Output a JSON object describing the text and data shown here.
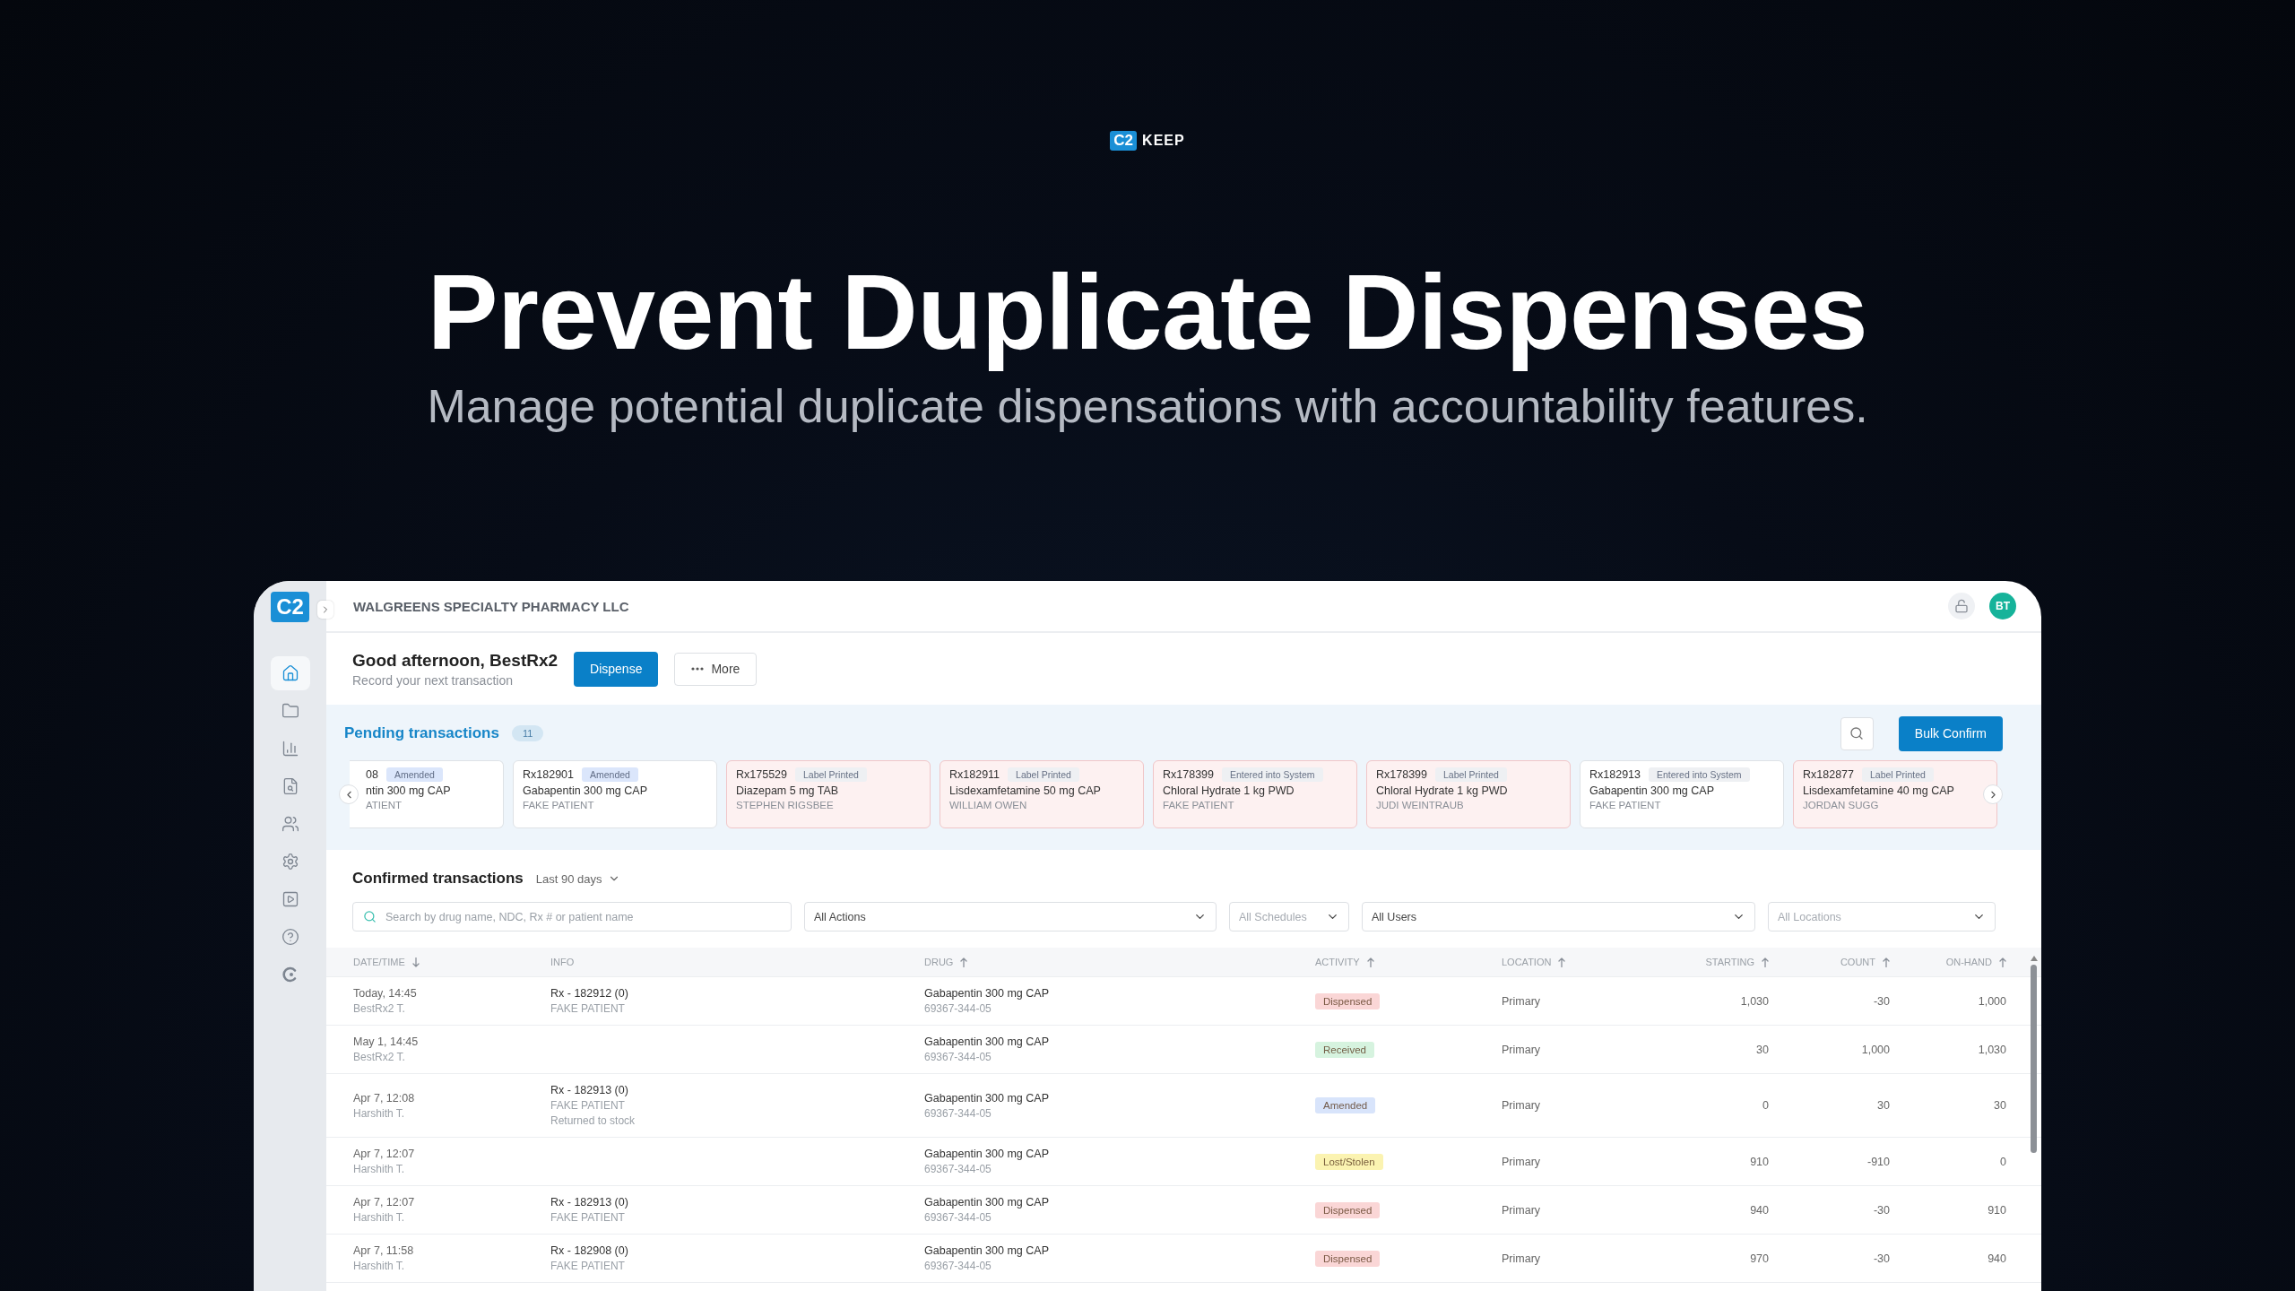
{
  "brand": {
    "mark": "C2",
    "name": "KEEP"
  },
  "headline": "Prevent Duplicate Dispenses",
  "subtitle": "Manage potential duplicate dispensations with accountability features.",
  "app": {
    "sidebar": {
      "logo": "C2",
      "nav": [
        {
          "selected": true
        },
        {
          "selected": false
        },
        {
          "selected": false
        },
        {
          "selected": false
        },
        {
          "selected": false
        },
        {
          "selected": false
        },
        {
          "selected": false
        },
        {
          "selected": false
        },
        {
          "selected": false
        }
      ]
    },
    "topbar": {
      "org": "WALGREENS SPECIALTY PHARMACY LLC",
      "locked": false,
      "avatar": "BT"
    },
    "greeting": {
      "title": "Good afternoon, BestRx2",
      "subtitle": "Record your next transaction"
    },
    "actions": [
      {
        "label": "Dispense",
        "kind": "primary"
      },
      {
        "label": "More",
        "kind": "more"
      }
    ],
    "pending": {
      "title": "Pending transactions",
      "count": "11",
      "bulk_button": "Bulk Confirm",
      "cards": [
        {
          "rx": "08",
          "status": {
            "label": "Amended",
            "color": "#dbe6fb"
          },
          "drug": "ntin 300 mg CAP",
          "patient": "ATIENT",
          "alert": false
        },
        {
          "rx": "Rx182901",
          "status": {
            "label": "Amended",
            "color": "#dbe6fb"
          },
          "drug": "Gabapentin 300 mg CAP",
          "patient": "FAKE PATIENT",
          "alert": false
        },
        {
          "rx": "Rx175529",
          "status": {
            "label": "Label Printed",
            "color": "#eef0f3"
          },
          "drug": "Diazepam 5 mg TAB",
          "patient": "STEPHEN RIGSBEE",
          "alert": true
        },
        {
          "rx": "Rx182911",
          "status": {
            "label": "Label Printed",
            "color": "#eef0f3"
          },
          "drug": "Lisdexamfetamine 50 mg CAP",
          "patient": "WILLIAM OWEN",
          "alert": true
        },
        {
          "rx": "Rx178399",
          "status": {
            "label": "Entered into System",
            "color": "#eef0f3"
          },
          "drug": "Chloral Hydrate 1 kg PWD",
          "patient": "FAKE PATIENT",
          "alert": true
        },
        {
          "rx": "Rx178399",
          "status": {
            "label": "Label Printed",
            "color": "#eef0f3"
          },
          "drug": "Chloral Hydrate 1 kg PWD",
          "patient": "JUDI WEINTRAUB",
          "alert": true
        },
        {
          "rx": "Rx182913",
          "status": {
            "label": "Entered into System",
            "color": "#eef0f3"
          },
          "drug": "Gabapentin 300 mg CAP",
          "patient": "FAKE PATIENT",
          "alert": false
        },
        {
          "rx": "Rx182877",
          "status": {
            "label": "Label Printed",
            "color": "#eef0f3"
          },
          "drug": "Lisdexamfetamine 40 mg CAP",
          "patient": "JORDAN SUGG",
          "alert": true
        }
      ]
    },
    "confirmed": {
      "title": "Confirmed transactions",
      "range": "Last 90 days",
      "search": {
        "placeholder": "Search by drug name, NDC, Rx # or patient name"
      },
      "filters": [
        {
          "value": "All Actions"
        },
        {
          "placeholder": "All Schedules"
        },
        {
          "value": "All Users"
        },
        {
          "placeholder": "All Locations"
        }
      ],
      "columns": [
        {
          "label": "DATE/TIME",
          "sorted": true,
          "descending": true
        },
        {
          "label": "INFO",
          "sorted": false
        },
        {
          "label": "DRUG",
          "sorted": true,
          "descending": false
        },
        {
          "label": "ACTIVITY",
          "sorted": true,
          "descending": false
        },
        {
          "label": "LOCATION",
          "sorted": true,
          "descending": false
        },
        {
          "label": "STARTING",
          "sorted": true,
          "descending": false
        },
        {
          "label": "COUNT",
          "sorted": true,
          "descending": false
        },
        {
          "label": "ON-HAND",
          "sorted": true,
          "descending": false
        }
      ],
      "rows": [
        {
          "date": "Today, 14:45",
          "user": "BestRx2 T.",
          "info": {
            "rx": "Rx - 182912 (0)",
            "patient": "FAKE PATIENT"
          },
          "drug": "Gabapentin 300 mg CAP",
          "ndc": "69367-344-05",
          "activity": {
            "label": "Dispensed",
            "color": "#fad6d6"
          },
          "location": "Primary",
          "starting": "1,030",
          "count": "-30",
          "on_hand": "1,000"
        },
        {
          "date": "May 1, 14:45",
          "user": "BestRx2 T.",
          "drug": "Gabapentin 300 mg CAP",
          "ndc": "69367-344-05",
          "activity": {
            "label": "Received",
            "color": "#d6f3df"
          },
          "location": "Primary",
          "starting": "30",
          "count": "1,000",
          "on_hand": "1,030"
        },
        {
          "date": "Apr 7, 12:08",
          "user": "Harshith T.",
          "info": {
            "rx": "Rx - 182913 (0)",
            "patient": "FAKE PATIENT",
            "note": "Returned to stock"
          },
          "drug": "Gabapentin 300 mg CAP",
          "ndc": "69367-344-05",
          "activity": {
            "label": "Amended",
            "color": "#d8e4fb"
          },
          "location": "Primary",
          "starting": "0",
          "count": "30",
          "on_hand": "30"
        },
        {
          "date": "Apr 7, 12:07",
          "user": "Harshith T.",
          "drug": "Gabapentin 300 mg CAP",
          "ndc": "69367-344-05",
          "activity": {
            "label": "Lost/Stolen",
            "color": "#fbf3b1"
          },
          "location": "Primary",
          "starting": "910",
          "count": "-910",
          "on_hand": "0"
        },
        {
          "date": "Apr 7, 12:07",
          "user": "Harshith T.",
          "info": {
            "rx": "Rx - 182913 (0)",
            "patient": "FAKE PATIENT"
          },
          "drug": "Gabapentin 300 mg CAP",
          "ndc": "69367-344-05",
          "activity": {
            "label": "Dispensed",
            "color": "#fad6d6"
          },
          "location": "Primary",
          "starting": "940",
          "count": "-30",
          "on_hand": "910"
        },
        {
          "date": "Apr 7, 11:58",
          "user": "Harshith T.",
          "info": {
            "rx": "Rx - 182908 (0)",
            "patient": "FAKE PATIENT"
          },
          "drug": "Gabapentin 300 mg CAP",
          "ndc": "69367-344-05",
          "activity": {
            "label": "Dispensed",
            "color": "#fad6d6"
          },
          "location": "Primary",
          "starting": "970",
          "count": "-30",
          "on_hand": "940"
        }
      ]
    }
  }
}
